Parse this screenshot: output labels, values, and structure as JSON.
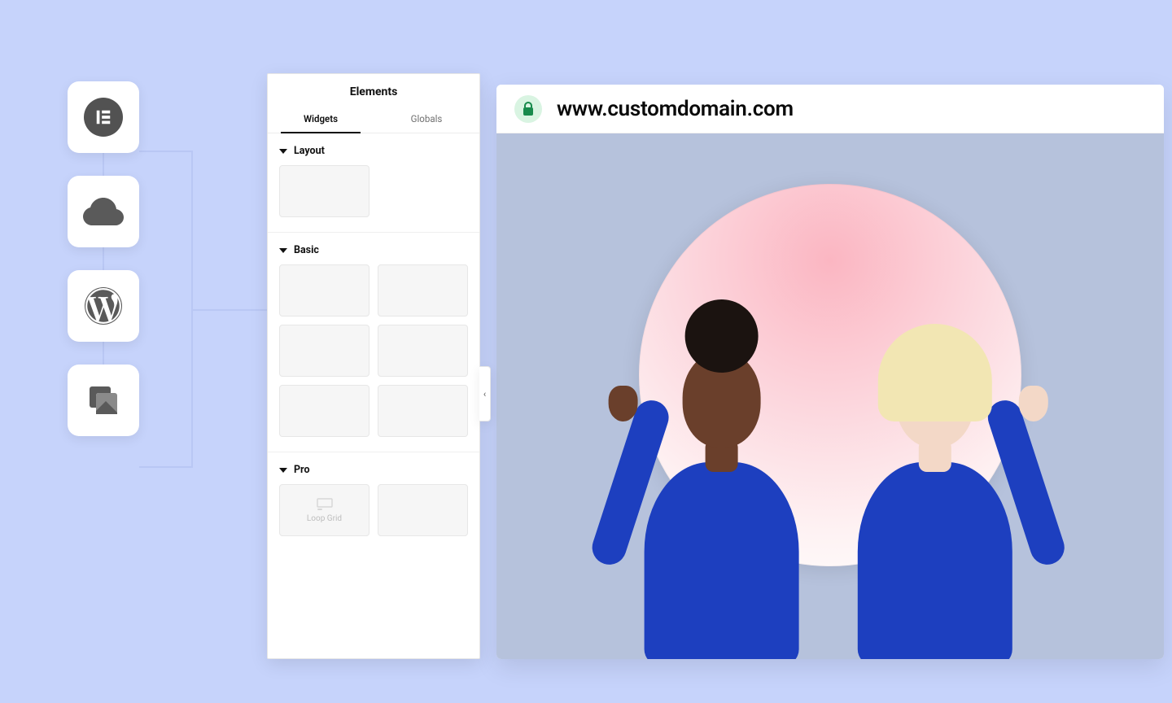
{
  "sidebar_icons": [
    {
      "name": "elementor-icon"
    },
    {
      "name": "cloud-icon"
    },
    {
      "name": "wordpress-icon"
    },
    {
      "name": "templates-icon"
    }
  ],
  "panel": {
    "title": "Elements",
    "tabs": {
      "widgets": "Widgets",
      "globals": "Globals",
      "active": "widgets"
    },
    "sections": {
      "layout": {
        "label": "Layout",
        "widget_count": 1
      },
      "basic": {
        "label": "Basic",
        "widget_count": 6
      },
      "pro": {
        "label": "Pro",
        "widget_count": 2,
        "loop_grid_label": "Loop Grid"
      }
    },
    "collapse_glyph": "‹"
  },
  "browser": {
    "url": "www.customdomain.com",
    "lock_icon": "lock-icon"
  },
  "preview": {
    "background_description": "Two people in cobalt-blue tops peer through a circular pink-gradient cut-out in a lilac wall"
  }
}
